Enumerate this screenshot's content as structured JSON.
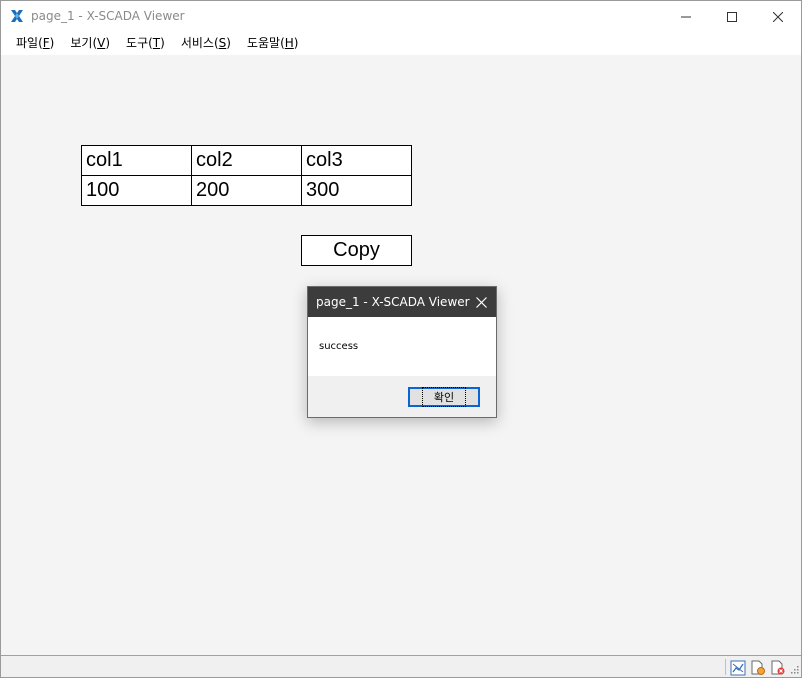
{
  "window": {
    "title": "page_1 - X-SCADA Viewer",
    "accent": "#1e88e5"
  },
  "menu": [
    {
      "label": "파일(",
      "key": "F",
      "end": ")"
    },
    {
      "label": "보기(",
      "key": "V",
      "end": ")"
    },
    {
      "label": "도구(",
      "key": "T",
      "end": ")"
    },
    {
      "label": "서비스(",
      "key": "S",
      "end": ")"
    },
    {
      "label": "도움말(",
      "key": "H",
      "end": ")"
    }
  ],
  "table": {
    "headers": [
      "col1",
      "col2",
      "col3"
    ],
    "values": [
      "100",
      "200",
      "300"
    ]
  },
  "copy_button": {
    "label": "Copy"
  },
  "dialog": {
    "title": "page_1 - X-SCADA Viewer",
    "message": "success",
    "ok_label": "확인"
  },
  "status_icons": [
    "chart-icon",
    "document-icon",
    "close-document-icon"
  ]
}
